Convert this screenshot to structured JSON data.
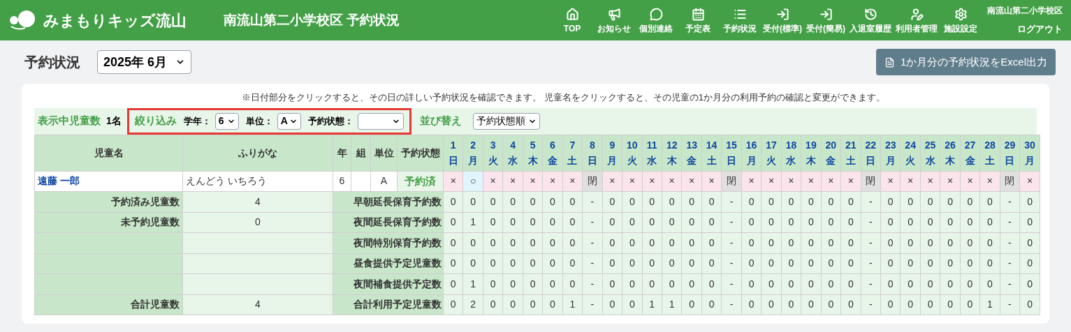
{
  "header": {
    "logo": "みまもりキッズ流山",
    "title": "南流山第二小学校区 予約状況",
    "nav": [
      {
        "label": "TOP"
      },
      {
        "label": "お知らせ"
      },
      {
        "label": "個別連絡"
      },
      {
        "label": "予定表"
      },
      {
        "label": "予約状況"
      },
      {
        "label": "受付(標準)"
      },
      {
        "label": "受付(簡易)"
      },
      {
        "label": "入退室履歴"
      },
      {
        "label": "利用者管理"
      },
      {
        "label": "施設設定"
      }
    ],
    "school": "南流山第二小学校区",
    "logout": "ログアウト"
  },
  "page_title": "予約状況",
  "month_select": "2025年 6月",
  "export_button": "1か月分の予約状況をExcel出力",
  "notice": "※日付部分をクリックすると、その日の詳しい予約状況を確認できます。 児童名をクリックすると、その児童の1か月分の利用予約の確認と変更ができます。",
  "filters": {
    "count_label": "表示中児童数",
    "count": "1名",
    "filter_label": "絞り込み",
    "grade_label": "学年：",
    "grade": "6",
    "unit_label": "単位：",
    "unit": "A",
    "status_label": "予約状態：",
    "sort_label": "並び替え",
    "sort": "予約状態順"
  },
  "table": {
    "columns": [
      "児童名",
      "ふりがな",
      "年",
      "組",
      "単位",
      "予約状態"
    ],
    "days": [
      {
        "d": "1",
        "w": "日"
      },
      {
        "d": "2",
        "w": "月"
      },
      {
        "d": "3",
        "w": "火"
      },
      {
        "d": "4",
        "w": "水"
      },
      {
        "d": "5",
        "w": "木"
      },
      {
        "d": "6",
        "w": "金"
      },
      {
        "d": "7",
        "w": "土"
      },
      {
        "d": "8",
        "w": "日"
      },
      {
        "d": "9",
        "w": "月"
      },
      {
        "d": "10",
        "w": "火"
      },
      {
        "d": "11",
        "w": "水"
      },
      {
        "d": "12",
        "w": "木"
      },
      {
        "d": "13",
        "w": "金"
      },
      {
        "d": "14",
        "w": "土"
      },
      {
        "d": "15",
        "w": "日"
      },
      {
        "d": "16",
        "w": "月"
      },
      {
        "d": "17",
        "w": "火"
      },
      {
        "d": "18",
        "w": "水"
      },
      {
        "d": "19",
        "w": "木"
      },
      {
        "d": "20",
        "w": "金"
      },
      {
        "d": "21",
        "w": "土"
      },
      {
        "d": "22",
        "w": "日"
      },
      {
        "d": "23",
        "w": "月"
      },
      {
        "d": "24",
        "w": "火"
      },
      {
        "d": "25",
        "w": "水"
      },
      {
        "d": "26",
        "w": "木"
      },
      {
        "d": "27",
        "w": "金"
      },
      {
        "d": "28",
        "w": "土"
      },
      {
        "d": "29",
        "w": "日"
      },
      {
        "d": "30",
        "w": "月"
      }
    ],
    "children": [
      {
        "name": "遠藤 一郎",
        "kana": "えんどう いちろう",
        "grade": "6",
        "unit": "A",
        "status": "予約済",
        "cells": [
          {
            "kind": "none",
            "mark": "×"
          },
          {
            "kind": "reserved",
            "mark": "○"
          },
          {
            "kind": "none",
            "mark": "×"
          },
          {
            "kind": "none",
            "mark": "×"
          },
          {
            "kind": "none",
            "mark": "×"
          },
          {
            "kind": "none",
            "mark": "×"
          },
          {
            "kind": "none",
            "mark": "×"
          },
          {
            "kind": "closed",
            "mark": "閉"
          },
          {
            "kind": "none",
            "mark": "×"
          },
          {
            "kind": "none",
            "mark": "×"
          },
          {
            "kind": "none",
            "mark": "×"
          },
          {
            "kind": "none",
            "mark": "×"
          },
          {
            "kind": "none",
            "mark": "×"
          },
          {
            "kind": "none",
            "mark": "×"
          },
          {
            "kind": "closed",
            "mark": "閉"
          },
          {
            "kind": "none",
            "mark": "×"
          },
          {
            "kind": "none",
            "mark": "×"
          },
          {
            "kind": "none",
            "mark": "×"
          },
          {
            "kind": "none",
            "mark": "×"
          },
          {
            "kind": "none",
            "mark": "×"
          },
          {
            "kind": "none",
            "mark": "×"
          },
          {
            "kind": "closed",
            "mark": "閉"
          },
          {
            "kind": "none",
            "mark": "×"
          },
          {
            "kind": "none",
            "mark": "×"
          },
          {
            "kind": "none",
            "mark": "×"
          },
          {
            "kind": "none",
            "mark": "×"
          },
          {
            "kind": "none",
            "mark": "×"
          },
          {
            "kind": "none",
            "mark": "×"
          },
          {
            "kind": "closed",
            "mark": "閉"
          },
          {
            "kind": "none",
            "mark": "×"
          }
        ]
      }
    ],
    "summary": [
      {
        "left_label": "予約済み児童数",
        "left_value": "4",
        "label": "早朝延長保育予約数",
        "values": [
          "0",
          "0",
          "0",
          "0",
          "0",
          "0",
          "0",
          "-",
          "0",
          "0",
          "0",
          "0",
          "0",
          "0",
          "-",
          "0",
          "0",
          "0",
          "0",
          "0",
          "0",
          "-",
          "0",
          "0",
          "0",
          "0",
          "0",
          "0",
          "-",
          "0"
        ]
      },
      {
        "left_label": "未予約児童数",
        "left_value": "0",
        "label": "夜間延長保育予約数",
        "values": [
          "0",
          "1",
          "0",
          "0",
          "0",
          "0",
          "0",
          "-",
          "0",
          "0",
          "0",
          "0",
          "0",
          "0",
          "-",
          "0",
          "0",
          "0",
          "0",
          "0",
          "0",
          "-",
          "0",
          "0",
          "0",
          "0",
          "0",
          "0",
          "-",
          "0"
        ]
      },
      {
        "label": "夜間特別保育予約数",
        "values": [
          "0",
          "0",
          "0",
          "0",
          "0",
          "0",
          "0",
          "-",
          "0",
          "0",
          "0",
          "0",
          "0",
          "0",
          "-",
          "0",
          "0",
          "0",
          "0",
          "0",
          "0",
          "-",
          "0",
          "0",
          "0",
          "0",
          "0",
          "0",
          "-",
          "0"
        ]
      },
      {
        "label": "昼食提供予定児童数",
        "values": [
          "0",
          "0",
          "0",
          "0",
          "0",
          "0",
          "0",
          "-",
          "0",
          "0",
          "0",
          "0",
          "0",
          "0",
          "-",
          "0",
          "0",
          "0",
          "0",
          "0",
          "0",
          "-",
          "0",
          "0",
          "0",
          "0",
          "0",
          "0",
          "-",
          "0"
        ]
      },
      {
        "label": "夜間補食提供予定数",
        "values": [
          "0",
          "1",
          "0",
          "0",
          "0",
          "0",
          "0",
          "-",
          "0",
          "0",
          "0",
          "0",
          "0",
          "0",
          "-",
          "0",
          "0",
          "0",
          "0",
          "0",
          "0",
          "-",
          "0",
          "0",
          "0",
          "0",
          "0",
          "0",
          "-",
          "0"
        ]
      },
      {
        "left_label": "合計児童数",
        "left_value": "4",
        "label": "合計利用予定児童数",
        "values": [
          "0",
          "2",
          "0",
          "0",
          "0",
          "0",
          "1",
          "-",
          "0",
          "0",
          "1",
          "1",
          "0",
          "0",
          "-",
          "0",
          "0",
          "0",
          "0",
          "0",
          "0",
          "-",
          "0",
          "0",
          "0",
          "0",
          "0",
          "1",
          "-",
          "0"
        ]
      }
    ]
  }
}
